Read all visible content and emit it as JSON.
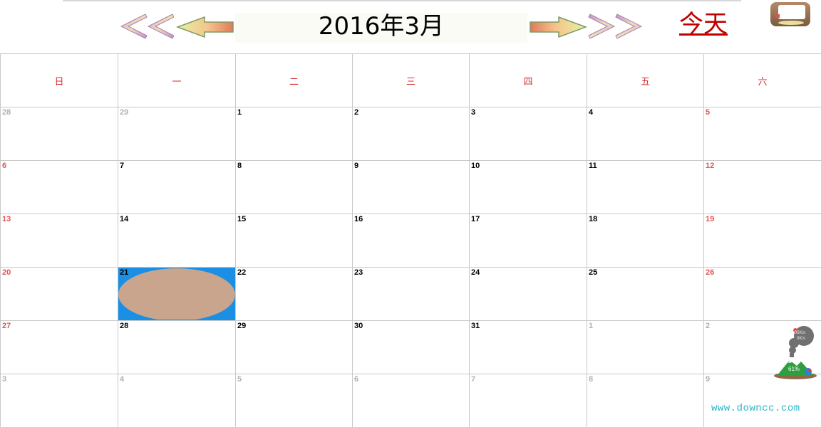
{
  "header": {
    "month_title": "2016年3月",
    "today_label": "今天"
  },
  "weekdays": [
    "日",
    "一",
    "二",
    "三",
    "四",
    "五",
    "六"
  ],
  "weeks": [
    [
      {
        "d": "28",
        "other": true
      },
      {
        "d": "29",
        "other": true
      },
      {
        "d": "1"
      },
      {
        "d": "2"
      },
      {
        "d": "3"
      },
      {
        "d": "4"
      },
      {
        "d": "5"
      }
    ],
    [
      {
        "d": "6"
      },
      {
        "d": "7"
      },
      {
        "d": "8"
      },
      {
        "d": "9"
      },
      {
        "d": "10"
      },
      {
        "d": "11"
      },
      {
        "d": "12"
      }
    ],
    [
      {
        "d": "13"
      },
      {
        "d": "14"
      },
      {
        "d": "15"
      },
      {
        "d": "16"
      },
      {
        "d": "17"
      },
      {
        "d": "18"
      },
      {
        "d": "19"
      }
    ],
    [
      {
        "d": "20"
      },
      {
        "d": "21",
        "selected": true
      },
      {
        "d": "22"
      },
      {
        "d": "23"
      },
      {
        "d": "24"
      },
      {
        "d": "25"
      },
      {
        "d": "26"
      }
    ],
    [
      {
        "d": "27"
      },
      {
        "d": "28"
      },
      {
        "d": "29"
      },
      {
        "d": "30"
      },
      {
        "d": "31"
      },
      {
        "d": "1",
        "other": true
      },
      {
        "d": "2",
        "other": true
      }
    ],
    [
      {
        "d": "3",
        "other": true
      },
      {
        "d": "4",
        "other": true
      },
      {
        "d": "5",
        "other": true
      },
      {
        "d": "6",
        "other": true
      },
      {
        "d": "7",
        "other": true
      },
      {
        "d": "8",
        "other": true
      },
      {
        "d": "9",
        "other": true
      }
    ]
  ],
  "icons": {
    "prev_year": "double-chevron-left-icon",
    "prev_month": "arrow-left-icon",
    "next_month": "arrow-right-icon",
    "next_year": "double-chevron-right-icon",
    "app": "app-window-icon"
  },
  "colors": {
    "weekday_text": "#d32f2f",
    "weekend_num": "#e45555",
    "other_month_num": "#b0b0b0",
    "selected_bg": "#1a8fe3",
    "selected_blob": "#c8a58c",
    "today_link": "#c00000"
  },
  "net_widget": {
    "speed_up": "0.05K/s",
    "speed_down": "0K/s",
    "percent": "61%"
  },
  "watermark": "www.downcc.com"
}
